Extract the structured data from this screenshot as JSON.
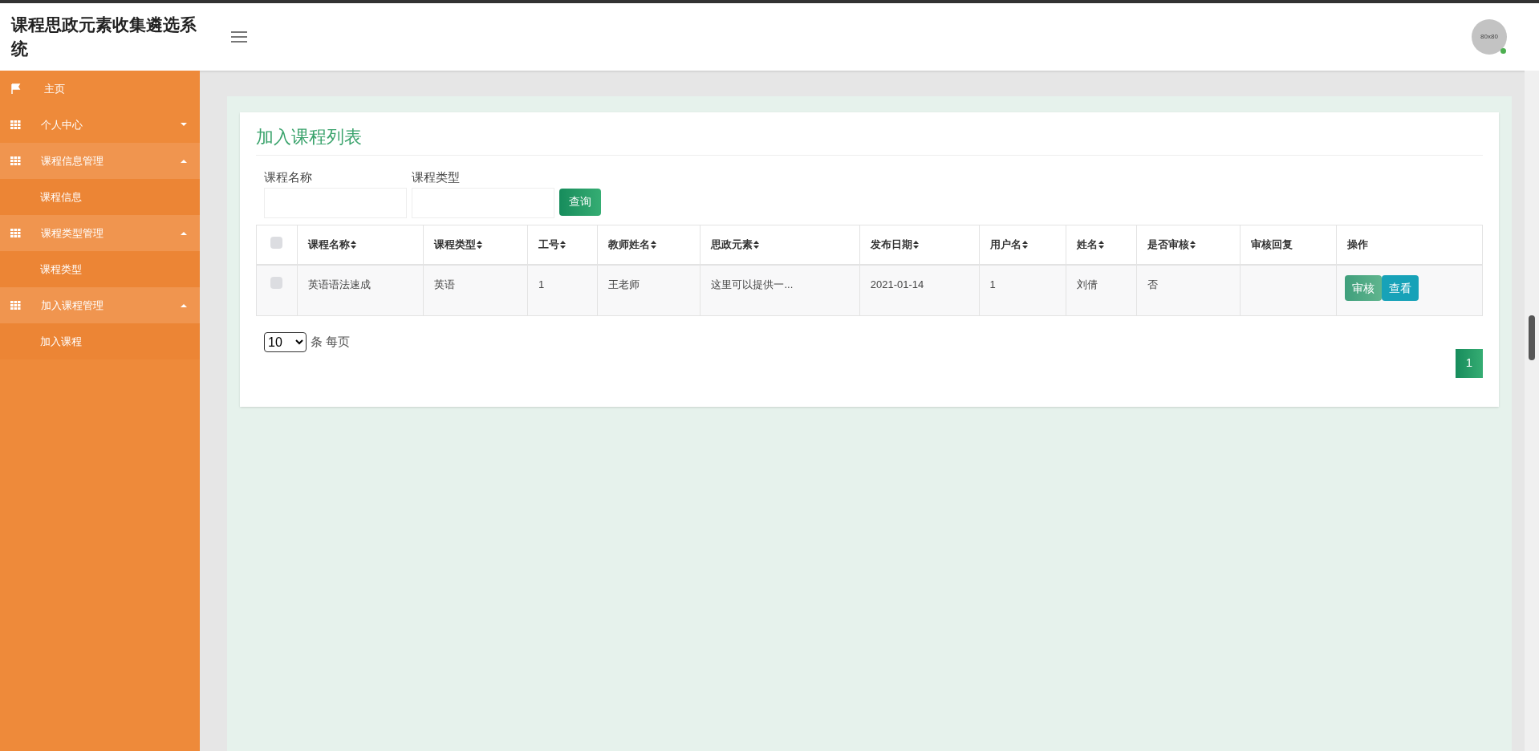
{
  "header": {
    "title": "课程思政元素收集遴选系统",
    "avatar_text": "80x80",
    "online": true
  },
  "sidebar": {
    "items": [
      {
        "label": "主页",
        "kind": "link"
      },
      {
        "label": "个人中心",
        "kind": "group",
        "expanded": false
      },
      {
        "label": "课程信息管理",
        "kind": "group",
        "expanded": true,
        "children": [
          {
            "label": "课程信息"
          }
        ]
      },
      {
        "label": "课程类型管理",
        "kind": "group",
        "expanded": true,
        "children": [
          {
            "label": "课程类型"
          }
        ]
      },
      {
        "label": "加入课程管理",
        "kind": "group",
        "expanded": true,
        "children": [
          {
            "label": "加入课程"
          }
        ]
      }
    ]
  },
  "page": {
    "title": "加入课程列表",
    "search": {
      "fields": [
        {
          "label": "课程名称"
        },
        {
          "label": "课程类型"
        }
      ],
      "button": "查询"
    },
    "table": {
      "header_checkbox": {
        "checked": false
      },
      "columns": [
        {
          "label": "课程名称",
          "sortable": true
        },
        {
          "label": "课程类型",
          "sortable": true
        },
        {
          "label": "工号",
          "sortable": true
        },
        {
          "label": "教师姓名",
          "sortable": true
        },
        {
          "label": "思政元素",
          "sortable": true
        },
        {
          "label": "发布日期",
          "sortable": true
        },
        {
          "label": "用户名",
          "sortable": true
        },
        {
          "label": "姓名",
          "sortable": true
        },
        {
          "label": "是否审核",
          "sortable": true
        },
        {
          "label": "审核回复",
          "sortable": false
        },
        {
          "label": "操作",
          "sortable": false
        }
      ],
      "rows": [
        {
          "checked": false,
          "cells": [
            "英语语法速成",
            "英语",
            "1",
            "王老师",
            "这里可以提供一...",
            "2021-01-14",
            "1",
            "刘倩",
            "否",
            ""
          ],
          "actions": [
            {
              "label": "审核",
              "kind": "review"
            },
            {
              "label": "查看",
              "kind": "view"
            }
          ]
        }
      ]
    },
    "page_size": {
      "value": "10",
      "suffix": "条 每页"
    },
    "pagination": [
      {
        "label": "1",
        "selected": true
      }
    ]
  }
}
